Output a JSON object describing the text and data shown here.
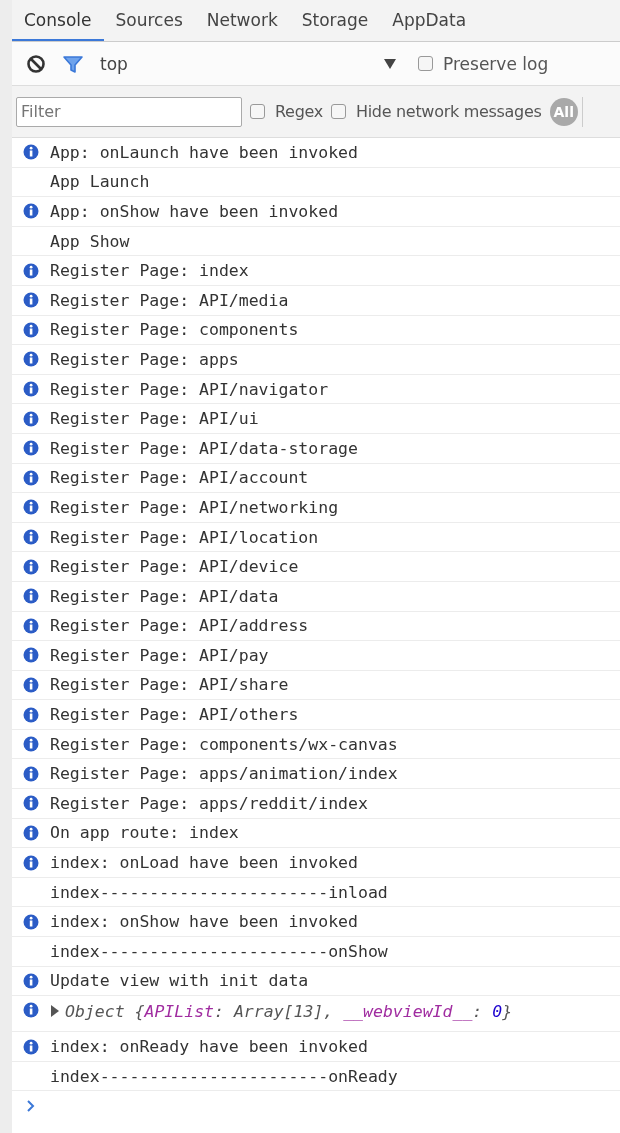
{
  "tabs": [
    {
      "label": "Console",
      "selected": true
    },
    {
      "label": "Sources",
      "selected": false
    },
    {
      "label": "Network",
      "selected": false
    },
    {
      "label": "Storage",
      "selected": false
    },
    {
      "label": "AppData",
      "selected": false
    }
  ],
  "toolbar": {
    "context": "top",
    "preserve_log": {
      "label": "Preserve log",
      "checked": false
    }
  },
  "filter_bar": {
    "placeholder": "Filter",
    "regex": {
      "label": "Regex",
      "checked": false
    },
    "hide_network": {
      "label": "Hide network messages",
      "checked": false
    },
    "levels": [
      {
        "label": "All",
        "selected": true
      }
    ]
  },
  "entries": [
    {
      "kind": "info",
      "text": "App: onLaunch have been invoked"
    },
    {
      "kind": "log",
      "text": "App Launch"
    },
    {
      "kind": "info",
      "text": "App: onShow have been invoked"
    },
    {
      "kind": "log",
      "text": "App Show"
    },
    {
      "kind": "info",
      "text": "Register Page: index"
    },
    {
      "kind": "info",
      "text": "Register Page: API/media"
    },
    {
      "kind": "info",
      "text": "Register Page: components"
    },
    {
      "kind": "info",
      "text": "Register Page: apps"
    },
    {
      "kind": "info",
      "text": "Register Page: API/navigator"
    },
    {
      "kind": "info",
      "text": "Register Page: API/ui"
    },
    {
      "kind": "info",
      "text": "Register Page: API/data-storage"
    },
    {
      "kind": "info",
      "text": "Register Page: API/account"
    },
    {
      "kind": "info",
      "text": "Register Page: API/networking"
    },
    {
      "kind": "info",
      "text": "Register Page: API/location"
    },
    {
      "kind": "info",
      "text": "Register Page: API/device"
    },
    {
      "kind": "info",
      "text": "Register Page: API/data"
    },
    {
      "kind": "info",
      "text": "Register Page: API/address"
    },
    {
      "kind": "info",
      "text": "Register Page: API/pay"
    },
    {
      "kind": "info",
      "text": "Register Page: API/share"
    },
    {
      "kind": "info",
      "text": "Register Page: API/others"
    },
    {
      "kind": "info",
      "text": "Register Page: components/wx-canvas"
    },
    {
      "kind": "info",
      "text": "Register Page: apps/animation/index"
    },
    {
      "kind": "info",
      "text": "Register Page: apps/reddit/index"
    },
    {
      "kind": "info",
      "text": "On app route: index"
    },
    {
      "kind": "info",
      "text": "index: onLoad have been invoked"
    },
    {
      "kind": "log",
      "text": "index-----------------------inload"
    },
    {
      "kind": "info",
      "text": "index: onShow have been invoked"
    },
    {
      "kind": "log",
      "text": "index-----------------------onShow"
    },
    {
      "kind": "info",
      "text": "Update view with init data"
    },
    {
      "kind": "object",
      "expanded": false,
      "parts": [
        {
          "kind": "plain",
          "text": "Object {"
        },
        {
          "kind": "key",
          "text": "APIList"
        },
        {
          "kind": "plain",
          "text": ": Array[13], "
        },
        {
          "kind": "key",
          "text": "__webviewId__"
        },
        {
          "kind": "plain",
          "text": ": "
        },
        {
          "kind": "number",
          "text": "0"
        },
        {
          "kind": "plain",
          "text": "}"
        }
      ]
    },
    {
      "kind": "info",
      "text": "index: onReady have been invoked"
    },
    {
      "kind": "log",
      "text": "index-----------------------onReady"
    }
  ]
}
